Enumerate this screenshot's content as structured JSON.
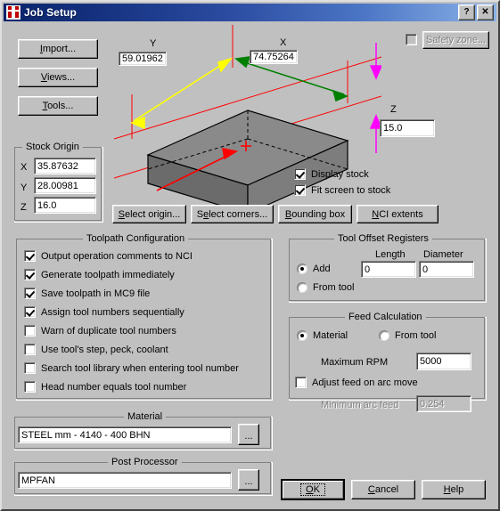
{
  "window": {
    "title": "Job Setup",
    "icon": "job-setup-icon",
    "help_button": "?",
    "close_button": "✕"
  },
  "left_buttons": [
    {
      "name": "import",
      "label": "Import...",
      "mnemonic": "I"
    },
    {
      "name": "views",
      "label": "Views...",
      "mnemonic": "V"
    },
    {
      "name": "tools",
      "label": "Tools...",
      "mnemonic": "T"
    }
  ],
  "safety_zone": {
    "checkbox_checked": false,
    "label": "Safety zone...",
    "disabled": true
  },
  "stock_preview": {
    "dim_y_label": "Y",
    "dim_y_value": "59.01962",
    "dim_x_label": "X",
    "dim_x_value": "74.75264",
    "dim_z_label": "Z",
    "dim_z_value": "15.0",
    "colors": {
      "y_arrow": "#ffff00",
      "x_arrow": "#008000",
      "z_arrow": "#ff00ff",
      "origin_axis": "#ff0000",
      "box_top": "#808080",
      "box_front": "#6e6e6e",
      "box_side": "#7a7a7a"
    }
  },
  "stock_origin": {
    "caption": "Stock Origin",
    "rows": [
      {
        "label": "X",
        "value": "35.87632"
      },
      {
        "label": "Y",
        "value": "28.00981"
      },
      {
        "label": "Z",
        "value": "16.0"
      }
    ]
  },
  "display_options": [
    {
      "name": "display-stock",
      "label": "Display stock",
      "checked": true
    },
    {
      "name": "fit-screen-to-stock",
      "label": "Fit screen to stock",
      "checked": true
    }
  ],
  "stock_buttons": [
    {
      "name": "select-origin",
      "label": "Select origin...",
      "mnemonic": "S"
    },
    {
      "name": "select-corners",
      "label": "Select corners...",
      "mnemonic": "e"
    },
    {
      "name": "bounding-box",
      "label": "Bounding box",
      "mnemonic": "B"
    },
    {
      "name": "nci-extents",
      "label": "NCI extents",
      "mnemonic": "N"
    }
  ],
  "toolpath_configuration": {
    "caption": "Toolpath Configuration",
    "items": [
      {
        "name": "output-operation-comments",
        "label": "Output operation comments to NCI",
        "checked": true
      },
      {
        "name": "generate-toolpath-immediately",
        "label": "Generate toolpath immediately",
        "checked": true
      },
      {
        "name": "save-toolpath-in-mc9",
        "label": "Save toolpath in MC9 file",
        "checked": true
      },
      {
        "name": "assign-tool-numbers-sequentially",
        "label": "Assign tool numbers sequentially",
        "checked": true
      },
      {
        "name": "warn-duplicate-tool-numbers",
        "label": "Warn of duplicate tool numbers",
        "checked": false
      },
      {
        "name": "use-tools-step-peck-coolant",
        "label": "Use tool's step, peck, coolant",
        "checked": false
      },
      {
        "name": "search-tool-library",
        "label": "Search tool library when entering tool number",
        "checked": false
      },
      {
        "name": "head-number-equals-tool-number",
        "label": "Head number equals tool number",
        "checked": false
      }
    ]
  },
  "tool_offset_registers": {
    "caption": "Tool Offset Registers",
    "length_label": "Length",
    "diameter_label": "Diameter",
    "length_value": "0",
    "diameter_value": "0",
    "options": [
      {
        "name": "add",
        "label": "Add",
        "selected": true
      },
      {
        "name": "from-tool",
        "label": "From tool",
        "selected": false
      }
    ]
  },
  "feed_calculation": {
    "caption": "Feed Calculation",
    "options": [
      {
        "name": "material",
        "label": "Material",
        "selected": true
      },
      {
        "name": "from-tool",
        "label": "From tool",
        "selected": false
      }
    ],
    "max_rpm_label": "Maximum RPM",
    "max_rpm_value": "5000",
    "adjust_feed_label": "Adjust feed on arc move",
    "adjust_feed_checked": false,
    "min_arc_feed_label": "Minimum arc feed",
    "min_arc_feed_value": "0.254",
    "min_arc_feed_disabled": true
  },
  "material": {
    "caption": "Material",
    "value": "STEEL mm - 4140 - 400 BHN",
    "browse_label": "..."
  },
  "post_processor": {
    "caption": "Post Processor",
    "value": "MPFAN",
    "browse_label": "..."
  },
  "dialog_buttons": [
    {
      "name": "ok",
      "label": "OK",
      "mnemonic": "O",
      "default": true
    },
    {
      "name": "cancel",
      "label": "Cancel",
      "mnemonic": "C",
      "default": false
    },
    {
      "name": "help",
      "label": "Help",
      "mnemonic": "H",
      "default": false
    }
  ]
}
